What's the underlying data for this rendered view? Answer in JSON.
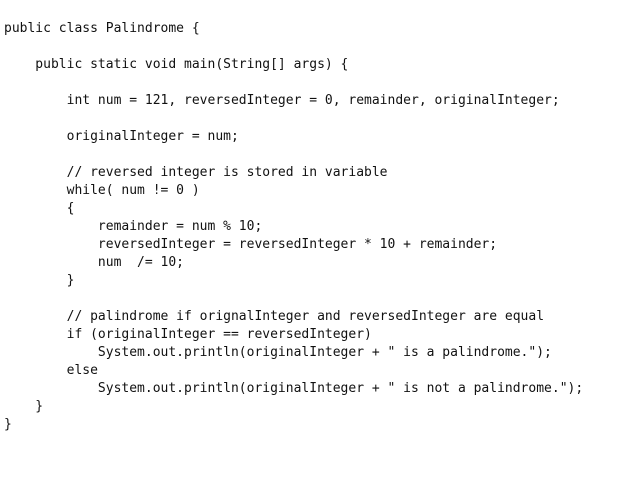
{
  "code": {
    "lines": [
      "public class Palindrome {",
      "",
      "    public static void main(String[] args) {",
      "",
      "        int num = 121, reversedInteger = 0, remainder, originalInteger;",
      "",
      "        originalInteger = num;",
      "",
      "        // reversed integer is stored in variable",
      "        while( num != 0 )",
      "        {",
      "            remainder = num % 10;",
      "            reversedInteger = reversedInteger * 10 + remainder;",
      "            num  /= 10;",
      "        }",
      "",
      "        // palindrome if orignalInteger and reversedInteger are equal",
      "        if (originalInteger == reversedInteger)",
      "            System.out.println(originalInteger + \" is a palindrome.\");",
      "        else",
      "            System.out.println(originalInteger + \" is not a palindrome.\");",
      "    }",
      "}"
    ]
  }
}
